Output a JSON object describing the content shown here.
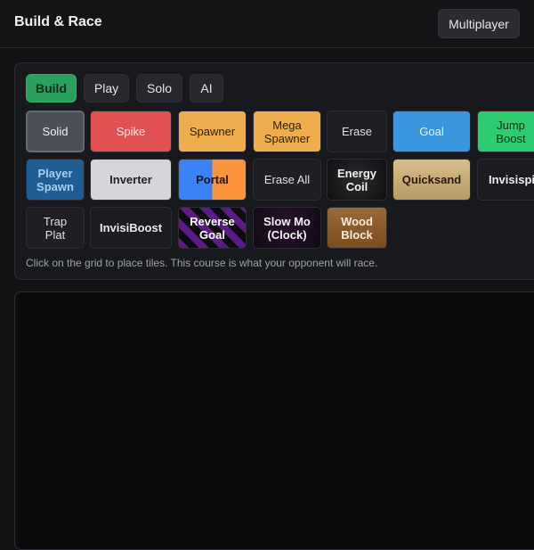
{
  "header": {
    "title": "Build & Race",
    "multiplayer_label": "Multiplayer"
  },
  "modes": [
    {
      "label": "Build",
      "active": true
    },
    {
      "label": "Play",
      "active": false
    },
    {
      "label": "Solo",
      "active": false
    },
    {
      "label": "AI",
      "active": false
    }
  ],
  "palette": {
    "row1": [
      "Solid",
      "Spike",
      "Spawner",
      "Mega Spawner",
      "Erase",
      "Goal",
      "Jump Boost"
    ],
    "row2": [
      "Player Spawn",
      "Inverter",
      "Portal",
      "Erase All",
      "Energy Coil",
      "Quicksand",
      "Invisispike"
    ],
    "row3": [
      "Trap Plat",
      "InvisiBoost",
      "Reverse Goal",
      "Slow Mo (Clock)",
      "Wood Block"
    ],
    "selected": "Solid"
  },
  "hint": "Click on the grid to place tiles. This course is what your opponent will race.",
  "colors": {
    "accent_green": "#27a15b",
    "spike": "#e05252",
    "spawner": "#f0ad4e",
    "goal": "#3a96dd",
    "jump_boost": "#2ecc71",
    "player_spawn": "#1f5d94",
    "inverter": "#d4d6d9",
    "portal_left": "#3b82f6",
    "portal_right": "#fb923c",
    "quicksand": "#c9ad7a",
    "wood_block": "#8a5a2b",
    "reverse_goal": "#5b1a86"
  }
}
